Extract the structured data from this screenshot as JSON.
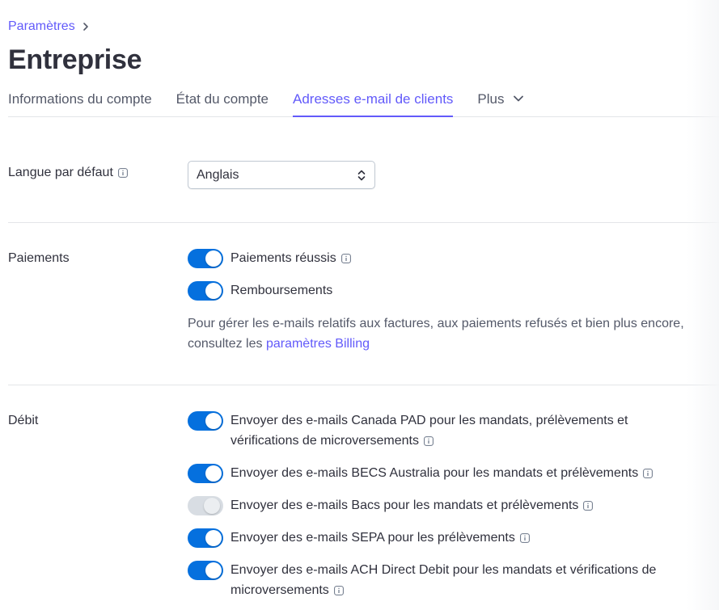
{
  "breadcrumb": {
    "parent": "Paramètres"
  },
  "page": {
    "title": "Entreprise"
  },
  "tabs": [
    {
      "label": "Informations du compte"
    },
    {
      "label": "État du compte"
    },
    {
      "label": "Adresses e-mail de clients",
      "active": true
    },
    {
      "label": "Plus"
    }
  ],
  "language": {
    "label": "Langue par défaut",
    "value": "Anglais"
  },
  "payments": {
    "label": "Paiements",
    "toggles": [
      {
        "label": "Paiements réussis",
        "on": true,
        "info": true
      },
      {
        "label": "Remboursements",
        "on": true,
        "info": false
      }
    ],
    "note_text": "Pour gérer les e-mails relatifs aux factures, aux paiements refusés et bien plus encore, consultez les ",
    "note_link": "paramètres Billing"
  },
  "debit": {
    "label": "Débit",
    "toggles": [
      {
        "line1": "Envoyer des e-mails Canada PAD pour les mandats, prélèvements et",
        "line2": "vérifications de microversements",
        "on": true
      },
      {
        "line1": "Envoyer des e-mails BECS Australia pour les mandats et prélèvements",
        "on": true
      },
      {
        "line1": "Envoyer des e-mails Bacs pour les mandats et prélèvements",
        "on": false
      },
      {
        "line1": "Envoyer des e-mails SEPA pour les prélèvements",
        "on": true
      },
      {
        "line1": "Envoyer des e-mails ACH Direct Debit pour les mandats et vérifications de",
        "line2": "microversements",
        "on": true
      }
    ]
  },
  "colors": {
    "accent": "#625afa",
    "toggle_on": "#0570de",
    "toggle_off": "#d8dde3",
    "text": "#30313d",
    "muted": "#545969",
    "divider": "#e3e5e8"
  },
  "icons": {
    "breadcrumb_separator": "chevron-right-icon",
    "more_tab": "chevron-down-icon",
    "select": "updown-chevron-icon",
    "info": "info-icon"
  }
}
